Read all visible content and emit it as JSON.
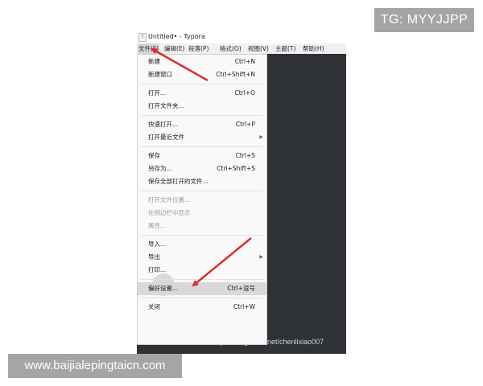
{
  "overlay": {
    "top_badge": "TG: MYYJJPP",
    "bottom_badge": "www.baijialepingtaicn.com",
    "blog_watermark": "https://blog.csdn.net/chenlixiao007"
  },
  "window": {
    "icon_letter": "T",
    "title": "Untitled• - Typora"
  },
  "menubar": [
    {
      "label": "文件(F)",
      "active": true
    },
    {
      "label": "编辑(E)"
    },
    {
      "label": "段落(P)"
    },
    {
      "label": "格式(O)"
    },
    {
      "label": "视图(V)"
    },
    {
      "label": "主题(T)"
    },
    {
      "label": "帮助(H)"
    }
  ],
  "file_menu": [
    {
      "label": "新建",
      "shortcut": "Ctrl+N"
    },
    {
      "label": "新建窗口",
      "shortcut": "Ctrl+Shift+N"
    },
    {
      "label": "打开...",
      "shortcut": "Ctrl+O"
    },
    {
      "label": "打开文件夹...",
      "shortcut": ""
    },
    {
      "label": "快速打开...",
      "shortcut": "Ctrl+P"
    },
    {
      "label": "打开最近文件",
      "shortcut": "",
      "submenu": true
    },
    {
      "label": "保存",
      "shortcut": "Ctrl+S"
    },
    {
      "label": "另存为...",
      "shortcut": "Ctrl+Shift+S"
    },
    {
      "label": "保存全部打开的文件...",
      "shortcut": ""
    },
    {
      "label": "打开文件位置...",
      "shortcut": "",
      "disabled": true
    },
    {
      "label": "在侧边栏中显示",
      "shortcut": "",
      "disabled": true
    },
    {
      "label": "属性...",
      "shortcut": "",
      "disabled": true
    },
    {
      "label": "导入...",
      "shortcut": ""
    },
    {
      "label": "导出",
      "shortcut": "",
      "submenu": true
    },
    {
      "label": "打印...",
      "shortcut": ""
    },
    {
      "label": "偏好设置...",
      "shortcut": "Ctrl+逗号",
      "highlight": true
    },
    {
      "label": "关闭",
      "shortcut": "Ctrl+W"
    }
  ],
  "submenu_arrow": "▶",
  "colors": {
    "editor_bg": "#363b40",
    "menu_bg": "#f9f9f9",
    "highlight": "#d9d9d9",
    "annotation_arrow": "#d9302a",
    "badge_bg": "#a5a5a5"
  }
}
